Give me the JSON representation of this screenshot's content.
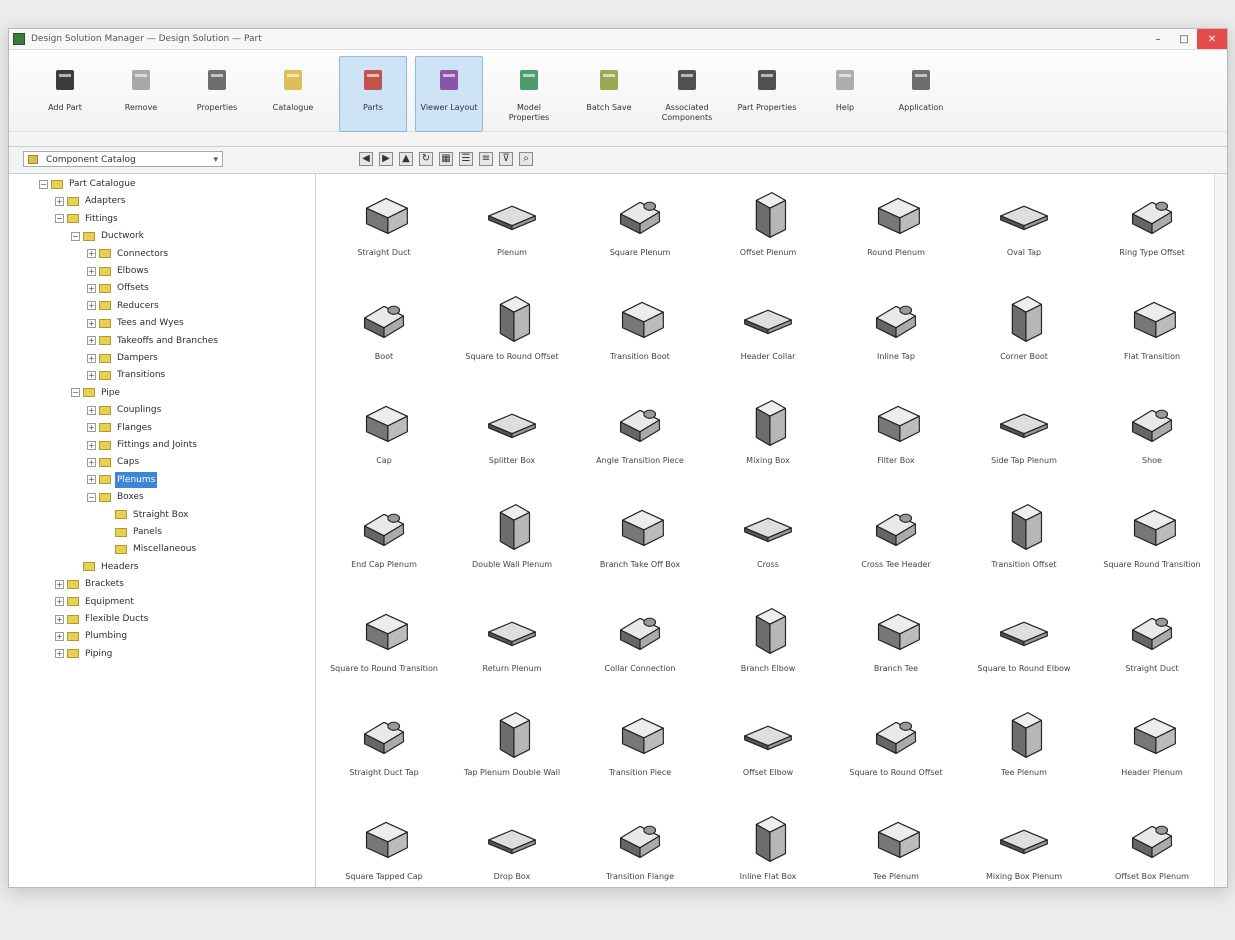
{
  "window": {
    "title": "Design Solution Manager — Design Solution — Part",
    "controls": {
      "minimize": "–",
      "maximize": "□",
      "close": "✕"
    }
  },
  "ribbon": {
    "buttons": [
      {
        "label": "Add Part",
        "icon": "add-part-icon",
        "color": "#1b1b1b"
      },
      {
        "label": "Remove",
        "icon": "remove-icon",
        "color": "#9a9a9a"
      },
      {
        "label": "Properties",
        "icon": "properties-icon",
        "color": "#555555"
      },
      {
        "label": "Catalogue",
        "icon": "catalogue-icon",
        "color": "#d9b43a"
      },
      {
        "label": "Parts",
        "icon": "parts-icon",
        "color": "#c0392b"
      },
      {
        "label": "Viewer Layout",
        "icon": "viewer-layout-icon",
        "color": "#7d3c98"
      },
      {
        "label": "Model Properties",
        "icon": "model-properties-icon",
        "color": "#2e8b57"
      },
      {
        "label": "Batch Save",
        "icon": "batch-save-icon",
        "color": "#8a9a3a"
      },
      {
        "label": "Associated Components",
        "icon": "associated-components-icon",
        "color": "#333333"
      },
      {
        "label": "Part Properties",
        "icon": "part-properties-icon",
        "color": "#333333"
      },
      {
        "label": "Help",
        "icon": "help-icon",
        "color": "#a0a0a0"
      },
      {
        "label": "Application",
        "icon": "application-icon",
        "color": "#555555"
      }
    ]
  },
  "toolbar": {
    "dropdown_value": "Component Catalog",
    "icons": [
      "back-icon",
      "forward-icon",
      "up-icon",
      "refresh-icon",
      "large-icons-icon",
      "list-icon",
      "details-icon",
      "filter-icon",
      "search-icon"
    ]
  },
  "tree": {
    "items": [
      {
        "label": "Part Catalogue",
        "level": 0,
        "exp": "−"
      },
      {
        "label": "Adapters",
        "level": 1,
        "exp": "+"
      },
      {
        "label": "Fittings",
        "level": 1,
        "exp": "−"
      },
      {
        "label": "Ductwork",
        "level": 2,
        "exp": "−"
      },
      {
        "label": "Connectors",
        "level": 3,
        "exp": "+"
      },
      {
        "label": "Elbows",
        "level": 3,
        "exp": "+"
      },
      {
        "label": "Offsets",
        "level": 3,
        "exp": "+"
      },
      {
        "label": "Reducers",
        "level": 3,
        "exp": "+"
      },
      {
        "label": "Tees and Wyes",
        "level": 3,
        "exp": "+"
      },
      {
        "label": "Takeoffs and Branches",
        "level": 3,
        "exp": "+"
      },
      {
        "label": "Dampers",
        "level": 3,
        "exp": "+"
      },
      {
        "label": "Transitions",
        "level": 3,
        "exp": "+"
      },
      {
        "label": "Pipe",
        "level": 2,
        "exp": "−"
      },
      {
        "label": "Couplings",
        "level": 3,
        "exp": "+"
      },
      {
        "label": "Flanges",
        "level": 3,
        "exp": "+"
      },
      {
        "label": "Fittings and Joints",
        "level": 3,
        "exp": "+"
      },
      {
        "label": "Caps",
        "level": 3,
        "exp": "+"
      },
      {
        "label": "Plenums",
        "level": 3,
        "exp": "+",
        "selected": true
      },
      {
        "label": "Boxes",
        "level": 3,
        "exp": "−"
      },
      {
        "label": "Straight Box",
        "level": 4,
        "exp": ""
      },
      {
        "label": "Panels",
        "level": 4,
        "exp": ""
      },
      {
        "label": "Miscellaneous",
        "level": 4,
        "exp": ""
      },
      {
        "label": "Headers",
        "level": 2,
        "exp": ""
      },
      {
        "label": "Brackets",
        "level": 1,
        "exp": "+"
      },
      {
        "label": "Equipment",
        "level": 1,
        "exp": "+"
      },
      {
        "label": "Flexible Ducts",
        "level": 1,
        "exp": "+"
      },
      {
        "label": "Plumbing",
        "level": 1,
        "exp": "+"
      },
      {
        "label": "Piping",
        "level": 1,
        "exp": "+"
      }
    ]
  },
  "parts": [
    {
      "label": "Straight Duct"
    },
    {
      "label": "Plenum"
    },
    {
      "label": "Square Plenum"
    },
    {
      "label": "Offset Plenum"
    },
    {
      "label": "Round Plenum"
    },
    {
      "label": "Oval Tap"
    },
    {
      "label": "Ring Type Offset"
    },
    {
      "label": "Boot"
    },
    {
      "label": "Square to Round Offset"
    },
    {
      "label": "Transition Boot"
    },
    {
      "label": "Header Collar"
    },
    {
      "label": "Inline Tap"
    },
    {
      "label": "Corner Boot"
    },
    {
      "label": "Flat Transition"
    },
    {
      "label": "Cap"
    },
    {
      "label": "Splitter Box"
    },
    {
      "label": "Angle Transition Piece"
    },
    {
      "label": "Mixing Box"
    },
    {
      "label": "Filter Box"
    },
    {
      "label": "Side Tap Plenum"
    },
    {
      "label": "Shoe"
    },
    {
      "label": "End Cap Plenum"
    },
    {
      "label": "Double Wall Plenum"
    },
    {
      "label": "Branch Take Off Box"
    },
    {
      "label": "Cross"
    },
    {
      "label": "Cross Tee Header"
    },
    {
      "label": "Transition Offset"
    },
    {
      "label": "Square Round Transition"
    },
    {
      "label": "Square to Round Transition"
    },
    {
      "label": "Return Plenum"
    },
    {
      "label": "Collar Connection"
    },
    {
      "label": "Branch Elbow"
    },
    {
      "label": "Branch Tee"
    },
    {
      "label": "Square to Round Elbow"
    },
    {
      "label": "Straight Duct"
    },
    {
      "label": "Straight Duct Tap"
    },
    {
      "label": "Tap Plenum Double Wall"
    },
    {
      "label": "Transition Piece"
    },
    {
      "label": "Offset Elbow"
    },
    {
      "label": "Square to Round Offset"
    },
    {
      "label": "Tee Plenum"
    },
    {
      "label": "Header Plenum"
    },
    {
      "label": "Square Tapped Cap"
    },
    {
      "label": "Drop Box"
    },
    {
      "label": "Transition Flange"
    },
    {
      "label": "Inline Flat Box"
    },
    {
      "label": "Tee Plenum"
    },
    {
      "label": "Mixing Box Plenum"
    },
    {
      "label": "Offset Box Plenum"
    }
  ]
}
